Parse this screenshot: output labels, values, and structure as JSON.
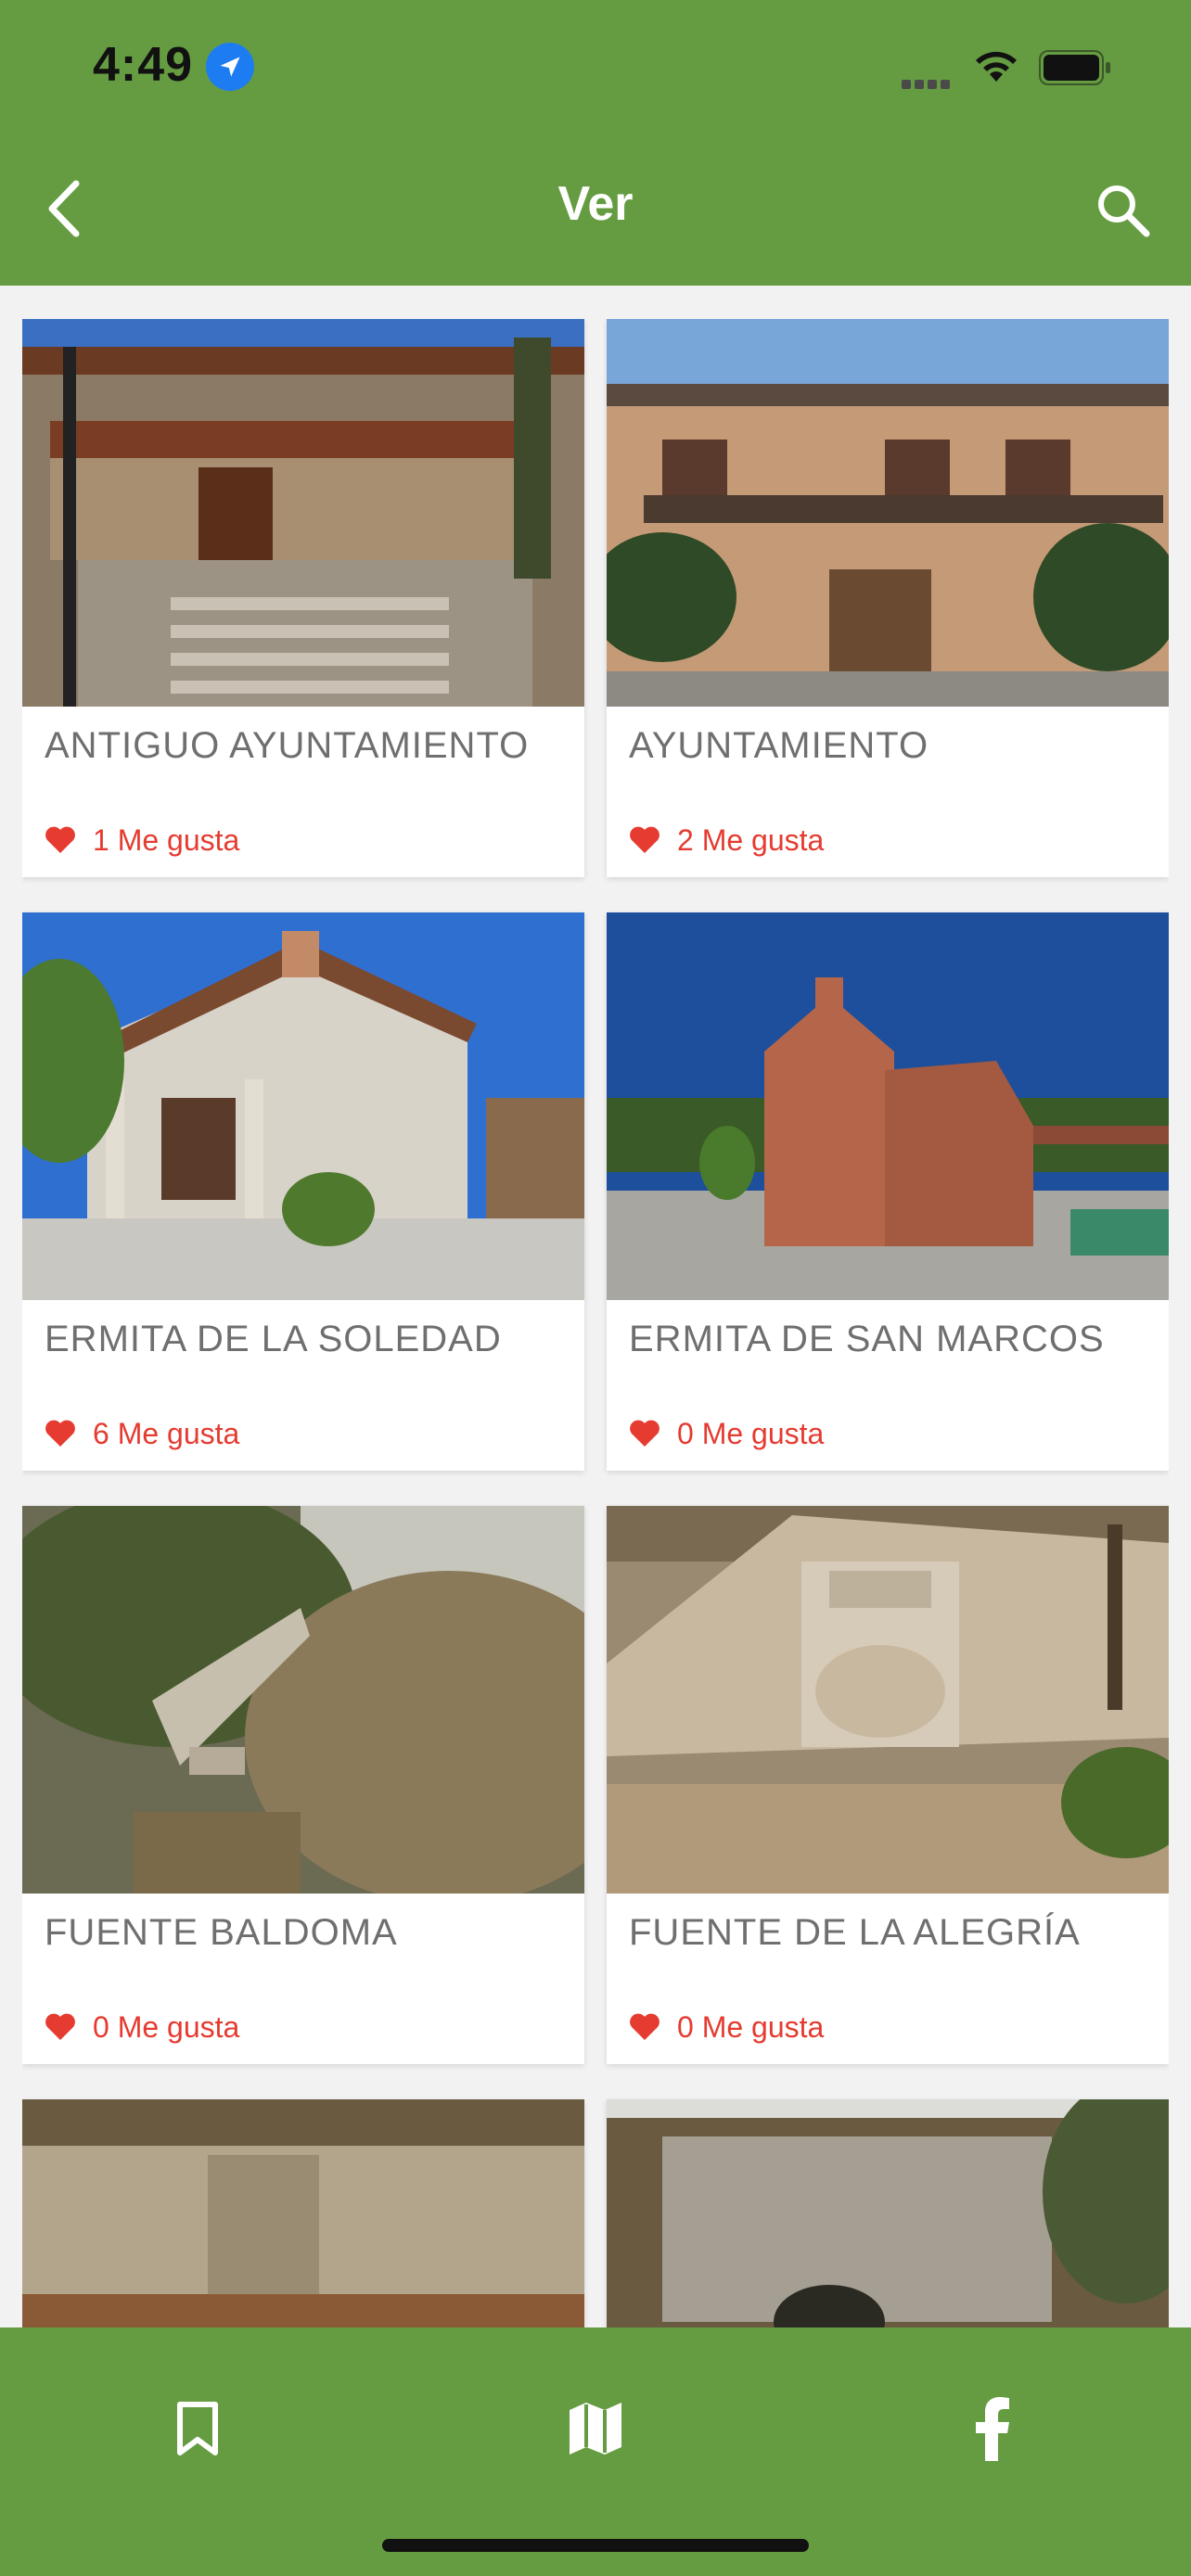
{
  "status_bar": {
    "time": "4:49"
  },
  "header": {
    "title": "Ver"
  },
  "places": [
    {
      "name": "ANTIGUO AYUNTAMIENTO",
      "likes": "1 Me gusta"
    },
    {
      "name": "AYUNTAMIENTO",
      "likes": "2 Me gusta"
    },
    {
      "name": "ERMITA DE LA SOLEDAD",
      "likes": "6 Me gusta"
    },
    {
      "name": "ERMITA DE SAN MARCOS",
      "likes": "0 Me gusta"
    },
    {
      "name": "FUENTE BALDOMA",
      "likes": "0 Me gusta"
    },
    {
      "name": "FUENTE DE LA ALEGRÍA",
      "likes": "0 Me gusta"
    },
    {
      "name": "",
      "likes": ""
    },
    {
      "name": "",
      "likes": ""
    }
  ],
  "bottom_nav": [
    {
      "icon": "bookmark-icon"
    },
    {
      "icon": "map-icon"
    },
    {
      "icon": "facebook-icon"
    }
  ],
  "colors": {
    "brand_green": "#659c41",
    "like_red": "#e53b30",
    "label_gray": "#6f6f6f"
  }
}
